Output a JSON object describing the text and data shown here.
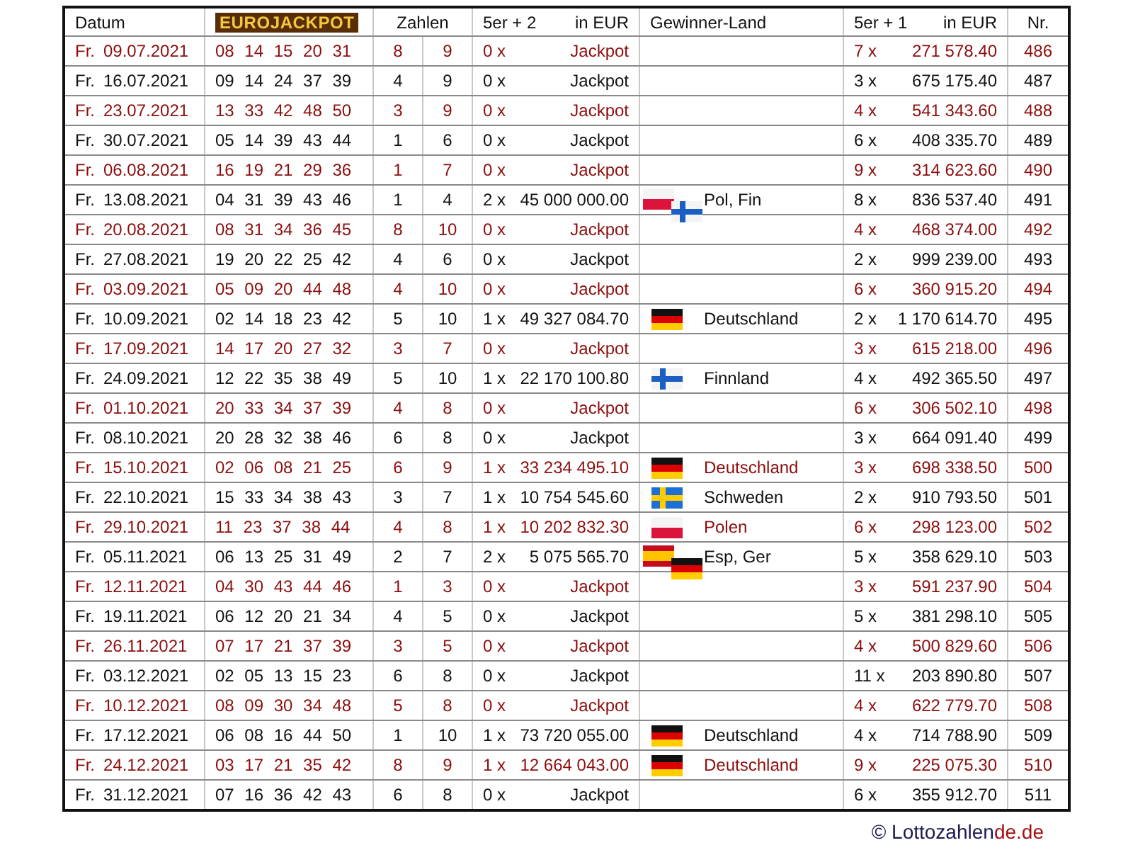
{
  "table": {
    "headers": {
      "date": "Datum",
      "logo": "EUROJACKPOT",
      "numbers": "Zahlen",
      "tier1": "5er + 2",
      "tier1_unit": "in EUR",
      "country": "Gewinner-Land",
      "tier2": "5er + 1",
      "tier2_unit": "in EUR",
      "nr": "Nr."
    },
    "rows": [
      {
        "day": "Fr.",
        "date": "09.07.2021",
        "numbers": "08 14 15 20 31",
        "euro1": "8",
        "euro2": "9",
        "winners1": "0 x",
        "prize1": "Jackpot",
        "winners2": "7 x",
        "prize2": "271 578.40",
        "nr": "486"
      },
      {
        "day": "Fr.",
        "date": "16.07.2021",
        "numbers": "09 14 24 37 39",
        "euro1": "4",
        "euro2": "9",
        "winners1": "0 x",
        "prize1": "Jackpot",
        "winners2": "3 x",
        "prize2": "675 175.40",
        "nr": "487"
      },
      {
        "day": "Fr.",
        "date": "23.07.2021",
        "numbers": "13 33 42 48 50",
        "euro1": "3",
        "euro2": "9",
        "winners1": "0 x",
        "prize1": "Jackpot",
        "winners2": "4 x",
        "prize2": "541 343.60",
        "nr": "488"
      },
      {
        "day": "Fr.",
        "date": "30.07.2021",
        "numbers": "05 14 39 43 44",
        "euro1": "1",
        "euro2": "6",
        "winners1": "0 x",
        "prize1": "Jackpot",
        "winners2": "6 x",
        "prize2": "408 335.70",
        "nr": "489"
      },
      {
        "day": "Fr.",
        "date": "06.08.2021",
        "numbers": "16 19 21 29 36",
        "euro1": "1",
        "euro2": "7",
        "winners1": "0 x",
        "prize1": "Jackpot",
        "winners2": "9 x",
        "prize2": "314 623.60",
        "nr": "490"
      },
      {
        "day": "Fr.",
        "date": "13.08.2021",
        "numbers": "04 31 39 43 46",
        "euro1": "1",
        "euro2": "4",
        "winners1": "2 x",
        "prize1": "45 000 000.00",
        "country": "Pol, Fin",
        "flags": [
          {
            "kind": "pl"
          },
          {
            "kind": "fi"
          }
        ],
        "winners2": "8 x",
        "prize2": "836 537.40",
        "nr": "491"
      },
      {
        "day": "Fr.",
        "date": "20.08.2021",
        "numbers": "08 31 34 36 45",
        "euro1": "8",
        "euro2": "10",
        "winners1": "0 x",
        "prize1": "Jackpot",
        "winners2": "4 x",
        "prize2": "468 374.00",
        "nr": "492"
      },
      {
        "day": "Fr.",
        "date": "27.08.2021",
        "numbers": "19 20 22 25 42",
        "euro1": "4",
        "euro2": "6",
        "winners1": "0 x",
        "prize1": "Jackpot",
        "winners2": "2 x",
        "prize2": "999 239.00",
        "nr": "493"
      },
      {
        "day": "Fr.",
        "date": "03.09.2021",
        "numbers": "05 09 20 44 48",
        "euro1": "4",
        "euro2": "10",
        "winners1": "0 x",
        "prize1": "Jackpot",
        "winners2": "6 x",
        "prize2": "360 915.20",
        "nr": "494"
      },
      {
        "day": "Fr.",
        "date": "10.09.2021",
        "numbers": "02 14 18 23 42",
        "euro1": "5",
        "euro2": "10",
        "winners1": "1 x",
        "prize1": "49 327 084.70",
        "country": "Deutschland",
        "flags": [
          {
            "kind": "de"
          }
        ],
        "winners2": "2 x",
        "prize2": "1 170 614.70",
        "nr": "495"
      },
      {
        "day": "Fr.",
        "date": "17.09.2021",
        "numbers": "14 17 20 27 32",
        "euro1": "3",
        "euro2": "7",
        "winners1": "0 x",
        "prize1": "Jackpot",
        "winners2": "3 x",
        "prize2": "615 218.00",
        "nr": "496"
      },
      {
        "day": "Fr.",
        "date": "24.09.2021",
        "numbers": "12 22 35 38 49",
        "euro1": "5",
        "euro2": "10",
        "winners1": "1 x",
        "prize1": "22 170 100.80",
        "country": "Finnland",
        "flags": [
          {
            "kind": "fi"
          }
        ],
        "winners2": "4 x",
        "prize2": "492 365.50",
        "nr": "497"
      },
      {
        "day": "Fr.",
        "date": "01.10.2021",
        "numbers": "20 33 34 37 39",
        "euro1": "4",
        "euro2": "8",
        "winners1": "0 x",
        "prize1": "Jackpot",
        "winners2": "6 x",
        "prize2": "306 502.10",
        "nr": "498"
      },
      {
        "day": "Fr.",
        "date": "08.10.2021",
        "numbers": "20 28 32 38 46",
        "euro1": "6",
        "euro2": "8",
        "winners1": "0 x",
        "prize1": "Jackpot",
        "winners2": "3 x",
        "prize2": "664 091.40",
        "nr": "499"
      },
      {
        "day": "Fr.",
        "date": "15.10.2021",
        "numbers": "02 06 08 21 25",
        "euro1": "6",
        "euro2": "9",
        "winners1": "1 x",
        "prize1": "33 234 495.10",
        "country": "Deutschland",
        "flags": [
          {
            "kind": "de"
          }
        ],
        "winners2": "3 x",
        "prize2": "698 338.50",
        "nr": "500"
      },
      {
        "day": "Fr.",
        "date": "22.10.2021",
        "numbers": "15 33 34 38 43",
        "euro1": "3",
        "euro2": "7",
        "winners1": "1 x",
        "prize1": "10 754 545.60",
        "country": "Schweden",
        "flags": [
          {
            "kind": "se"
          }
        ],
        "winners2": "2 x",
        "prize2": "910 793.50",
        "nr": "501"
      },
      {
        "day": "Fr.",
        "date": "29.10.2021",
        "numbers": "11 23 37 38 44",
        "euro1": "4",
        "euro2": "8",
        "winners1": "1 x",
        "prize1": "10 202 832.30",
        "country": "Polen",
        "flags": [
          {
            "kind": "pl"
          }
        ],
        "winners2": "6 x",
        "prize2": "298 123.00",
        "nr": "502"
      },
      {
        "day": "Fr.",
        "date": "05.11.2021",
        "numbers": "06 13 25 31 49",
        "euro1": "2",
        "euro2": "7",
        "winners1": "2 x",
        "prize1": "5 075 565.70",
        "country": "Esp, Ger",
        "flags": [
          {
            "kind": "es"
          },
          {
            "kind": "de"
          }
        ],
        "winners2": "5 x",
        "prize2": "358 629.10",
        "nr": "503"
      },
      {
        "day": "Fr.",
        "date": "12.11.2021",
        "numbers": "04 30 43 44 46",
        "euro1": "1",
        "euro2": "3",
        "winners1": "0 x",
        "prize1": "Jackpot",
        "winners2": "3 x",
        "prize2": "591 237.90",
        "nr": "504"
      },
      {
        "day": "Fr.",
        "date": "19.11.2021",
        "numbers": "06 12 20 21 34",
        "euro1": "4",
        "euro2": "5",
        "winners1": "0 x",
        "prize1": "Jackpot",
        "winners2": "5 x",
        "prize2": "381 298.10",
        "nr": "505"
      },
      {
        "day": "Fr.",
        "date": "26.11.2021",
        "numbers": "07 17 21 37 39",
        "euro1": "3",
        "euro2": "5",
        "winners1": "0 x",
        "prize1": "Jackpot",
        "winners2": "4 x",
        "prize2": "500 829.60",
        "nr": "506"
      },
      {
        "day": "Fr.",
        "date": "03.12.2021",
        "numbers": "02 05 13 15 23",
        "euro1": "6",
        "euro2": "8",
        "winners1": "0 x",
        "prize1": "Jackpot",
        "winners2": "11 x",
        "prize2": "203 890.80",
        "nr": "507"
      },
      {
        "day": "Fr.",
        "date": "10.12.2021",
        "numbers": "08 09 30 34 48",
        "euro1": "5",
        "euro2": "8",
        "winners1": "0 x",
        "prize1": "Jackpot",
        "winners2": "4 x",
        "prize2": "622 779.70",
        "nr": "508"
      },
      {
        "day": "Fr.",
        "date": "17.12.2021",
        "numbers": "06 08 16 44 50",
        "euro1": "1",
        "euro2": "10",
        "winners1": "1 x",
        "prize1": "73 720 055.00",
        "country": "Deutschland",
        "flags": [
          {
            "kind": "de"
          }
        ],
        "winners2": "4 x",
        "prize2": "714 788.90",
        "nr": "509"
      },
      {
        "day": "Fr.",
        "date": "24.12.2021",
        "numbers": "03 17 21 35 42",
        "euro1": "8",
        "euro2": "9",
        "winners1": "1 x",
        "prize1": "12 664 043.00",
        "country": "Deutschland",
        "flags": [
          {
            "kind": "de"
          }
        ],
        "winners2": "9 x",
        "prize2": "225 075.30",
        "nr": "510"
      },
      {
        "day": "Fr.",
        "date": "31.12.2021",
        "numbers": "07 16 36 42 43",
        "euro1": "6",
        "euro2": "8",
        "winners1": "0 x",
        "prize1": "Jackpot",
        "winners2": "6 x",
        "prize2": "355 912.70",
        "nr": "511"
      }
    ]
  },
  "footer": {
    "copyright": "© Lottozahlen",
    "domain": "de.de"
  }
}
